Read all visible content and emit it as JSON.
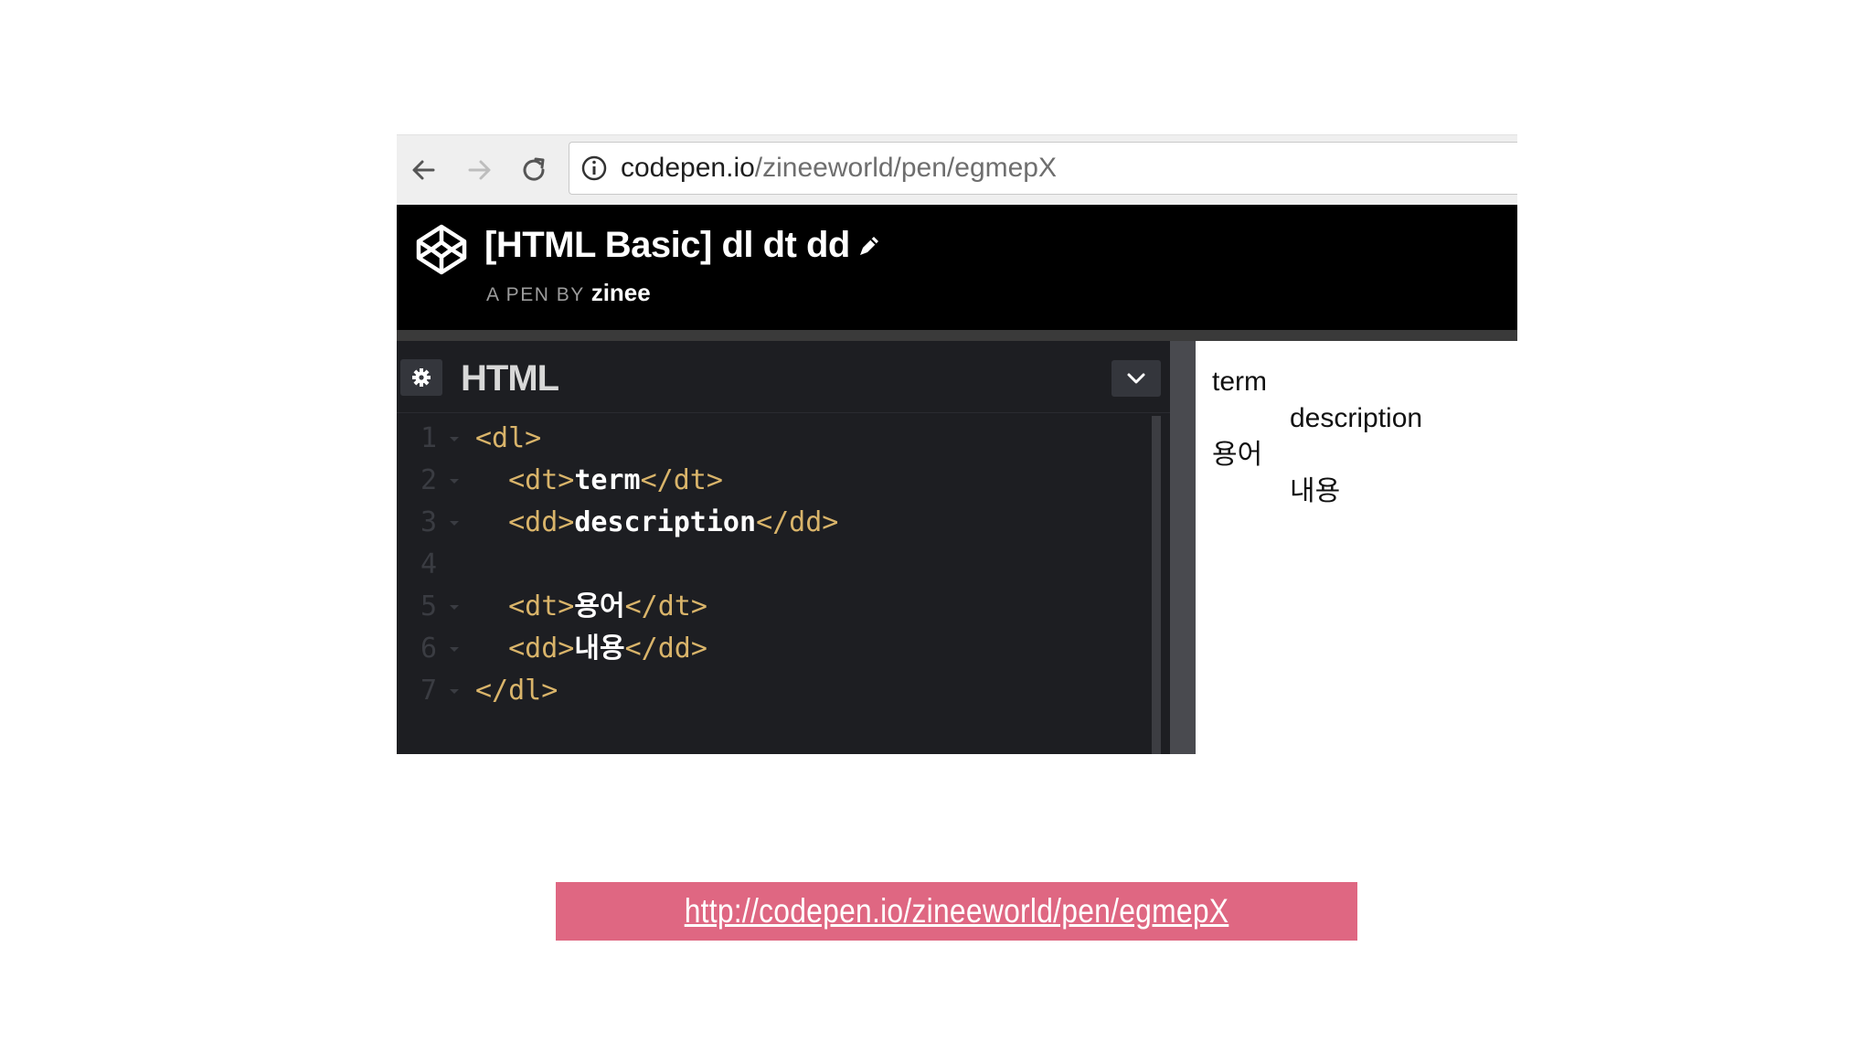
{
  "browser": {
    "url_domain": "codepen.io",
    "url_path": "/zineeworld/pen/egmepX",
    "icons": [
      "back-arrow-icon",
      "forward-arrow-icon",
      "reload-icon",
      "info-icon"
    ]
  },
  "pen": {
    "title": "[HTML Basic] dl dt dd",
    "byline": "A PEN BY",
    "author": "zinee"
  },
  "editor": {
    "title": "HTML",
    "lines": [
      {
        "num": "1",
        "indent": "",
        "parts": [
          [
            "tag",
            "<dl>"
          ]
        ]
      },
      {
        "num": "2",
        "indent": "  ",
        "parts": [
          [
            "tag",
            "<dt>"
          ],
          [
            "txt",
            "term"
          ],
          [
            "tag",
            "</dt>"
          ]
        ]
      },
      {
        "num": "3",
        "indent": "  ",
        "parts": [
          [
            "tag",
            "<dd>"
          ],
          [
            "txt",
            "description"
          ],
          [
            "tag",
            "</dd>"
          ]
        ]
      },
      {
        "num": "4",
        "indent": "",
        "parts": []
      },
      {
        "num": "5",
        "indent": "  ",
        "parts": [
          [
            "tag",
            "<dt>"
          ],
          [
            "txt",
            "용어"
          ],
          [
            "tag",
            "</dt>"
          ]
        ]
      },
      {
        "num": "6",
        "indent": "  ",
        "parts": [
          [
            "tag",
            "<dd>"
          ],
          [
            "txt",
            "내용"
          ],
          [
            "tag",
            "</dd>"
          ]
        ]
      },
      {
        "num": "7",
        "indent": "",
        "parts": [
          [
            "tag",
            "</dl>"
          ]
        ]
      }
    ]
  },
  "preview": {
    "items": [
      {
        "kind": "dt",
        "text": "term"
      },
      {
        "kind": "dd",
        "text": "description"
      },
      {
        "kind": "dt",
        "text": "용어"
      },
      {
        "kind": "dd",
        "text": "내용"
      }
    ]
  },
  "link": {
    "text": "http://codepen.io/zineeworld/pen/egmepX"
  },
  "colors": {
    "tag": "#d9b46a",
    "banner": "#df6782",
    "header_bg": "#000000",
    "editor_bg": "#1d1e22"
  }
}
